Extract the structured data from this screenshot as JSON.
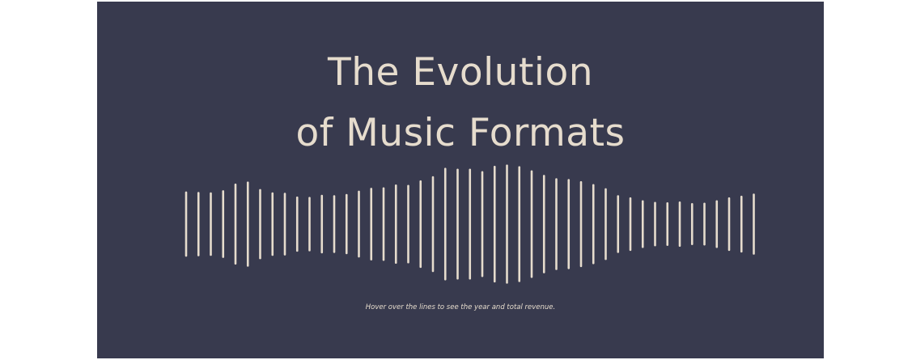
{
  "title": {
    "line1": "The Evolution",
    "line2": "of Music Formats"
  },
  "hint": "Hover over the lines to see the year and total revenue.",
  "colors": {
    "background": "#383a4e",
    "line": "#e6dccd",
    "text": "#e6dccd"
  },
  "chart_data": {
    "type": "bar",
    "note_style": "symmetric waveform lines centered on a baseline",
    "values": [
      76,
      75,
      74,
      79,
      95,
      100,
      82,
      74,
      73,
      64,
      63,
      68,
      67,
      70,
      78,
      85,
      86,
      93,
      92,
      103,
      113,
      133,
      131,
      131,
      125,
      138,
      141,
      137,
      127,
      116,
      108,
      106,
      101,
      94,
      84,
      67,
      62,
      55,
      51,
      50,
      52,
      48,
      49,
      55,
      62,
      66,
      71
    ],
    "ylim": [
      0,
      150
    ]
  }
}
